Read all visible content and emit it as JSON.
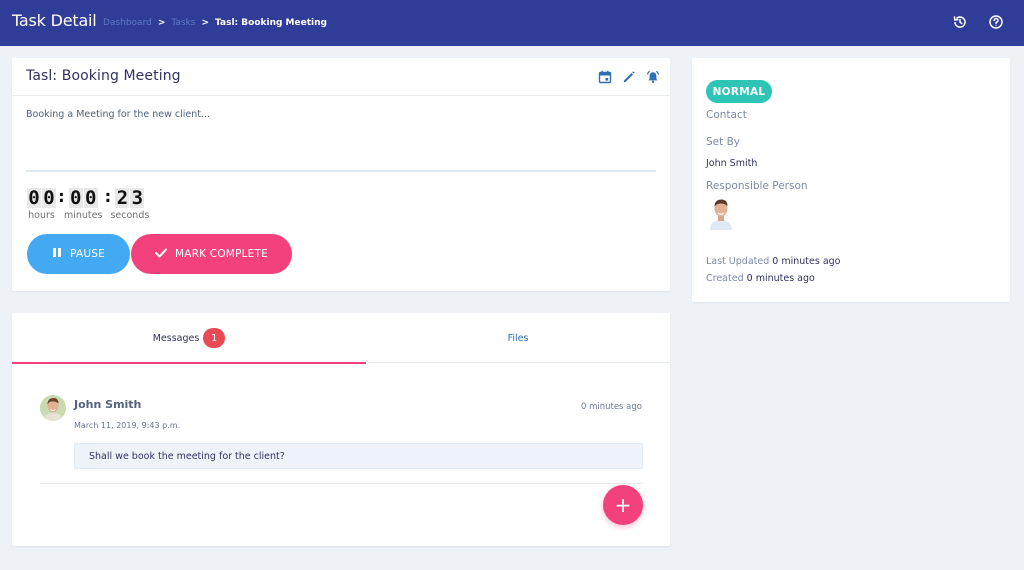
{
  "header": {
    "title": "Task Detail",
    "breadcrumb": {
      "dashboard": "Dashboard",
      "tasks": "Tasks",
      "current": "Tasl: Booking Meeting",
      "separator": ">"
    },
    "icons": [
      "history-icon",
      "help-icon"
    ]
  },
  "task": {
    "title": "Tasl: Booking Meeting",
    "description": "Booking a Meeting for the new client...",
    "actions": [
      "calendar-icon",
      "edit-icon",
      "alarm-icon"
    ],
    "timer": {
      "hours": [
        "0",
        "0"
      ],
      "minutes": [
        "0",
        "0"
      ],
      "seconds": [
        "2",
        "3"
      ],
      "hours_label": "hours",
      "minutes_label": "minutes",
      "seconds_label": "seconds"
    },
    "pause_label": "PAUSE",
    "complete_label": "MARK COMPLETE"
  },
  "details": {
    "status": "NORMAL",
    "contact_label": "Contact",
    "set_by_label": "Set By",
    "set_by_value": "John Smith",
    "responsible_label": "Responsible Person",
    "last_updated_label": "Last Updated",
    "last_updated_value": "0 minutes ago",
    "created_label": "Created",
    "created_value": "0 minutes ago"
  },
  "tabs": {
    "messages_label": "Messages",
    "messages_count": "1",
    "files_label": "Files"
  },
  "messages": [
    {
      "author": "John Smith",
      "time_ago": "0 minutes ago",
      "date": "March 11, 2019, 9:43 p.m.",
      "text": "Shall we book the meeting for the client?"
    }
  ],
  "fab_label": "+",
  "colors": {
    "header": "#2f3c98",
    "accent_pink": "#f3417e",
    "accent_blue": "#43a9f3",
    "status_teal": "#2ec4b6",
    "badge_red": "#e84a56",
    "background": "#eef2f7"
  }
}
